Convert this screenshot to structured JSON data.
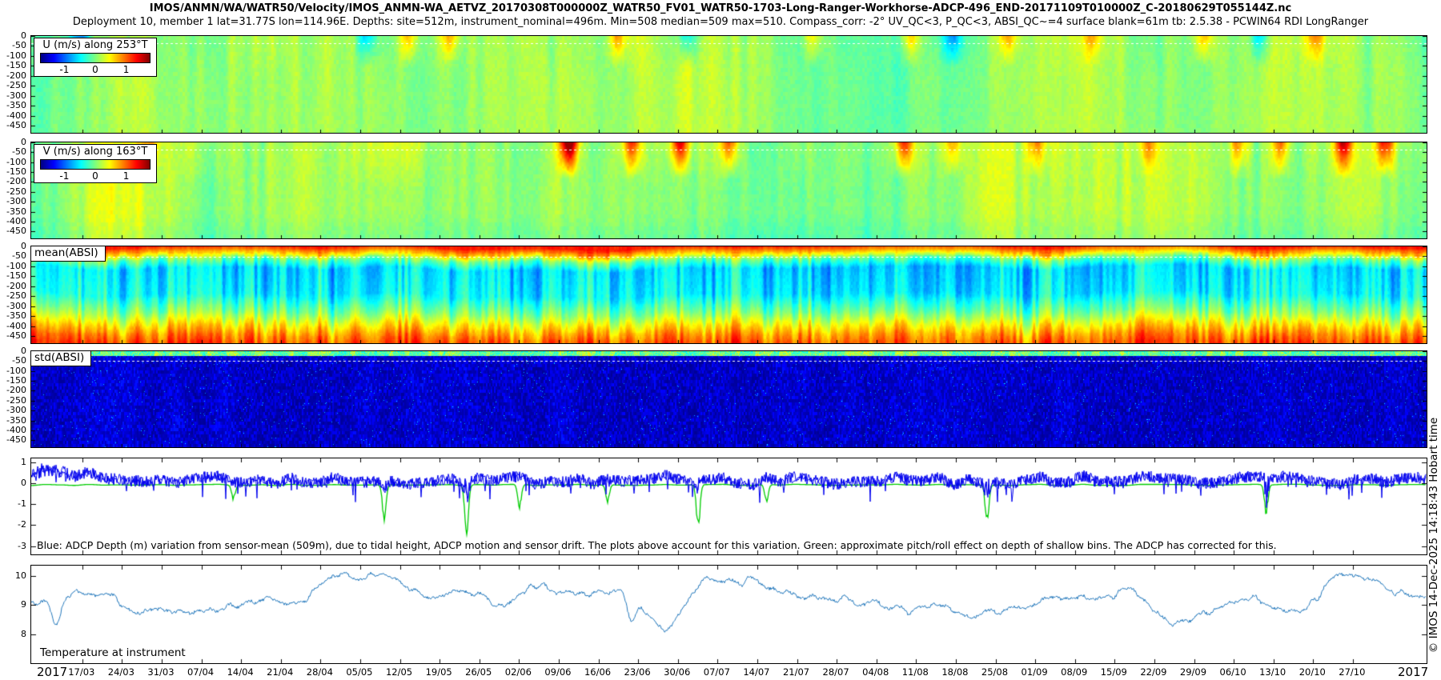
{
  "header": {
    "line1": "IMOS/ANMN/WA/WATR50/Velocity/IMOS_ANMN-WA_AETVZ_20170308T000000Z_WATR50_FV01_WATR50-1703-Long-Ranger-Workhorse-ADCP-496_END-20171109T010000Z_C-20180629T055144Z.nc",
    "line2": "Deployment 10, member 1 lat=31.77S lon=114.96E. Depths: site=512m, instrument_nominal=496m. Min=508 median=509 max=510. Compass_corr: -2° UV_QC<3, P_QC<3, ABSI_QC~=4 surface blank=61m tb: 2.5.38 - PCWIN64 RDI LongRanger"
  },
  "panels": [
    {
      "id": "u_velocity",
      "legend_title": "U (m/s) along 253°T",
      "colorbar_ticks": [
        "-1",
        "0",
        "1"
      ],
      "y_tick_labels": [
        "0",
        "-50",
        "-100",
        "-150",
        "-200",
        "-250",
        "-300",
        "-350",
        "-400",
        "-450"
      ]
    },
    {
      "id": "v_velocity",
      "legend_title": "V (m/s) along 163°T",
      "colorbar_ticks": [
        "-1",
        "0",
        "1"
      ],
      "y_tick_labels": [
        "0",
        "-50",
        "-100",
        "-150",
        "-200",
        "-250",
        "-300",
        "-350",
        "-400",
        "-450"
      ]
    },
    {
      "id": "mean_absi",
      "label": "mean(ABSI)",
      "y_tick_labels": [
        "0",
        "-50",
        "-100",
        "-150",
        "-200",
        "-250",
        "-300",
        "-350",
        "-400",
        "-450"
      ]
    },
    {
      "id": "std_absi",
      "label": "std(ABSI)",
      "y_tick_labels": [
        "0",
        "-50",
        "-100",
        "-150",
        "-200",
        "-250",
        "-300",
        "-350",
        "-400",
        "-450"
      ]
    },
    {
      "id": "depth_variation",
      "y_tick_labels": [
        "1",
        "0",
        "-1",
        "-2",
        "-3"
      ],
      "annotation": "Blue: ADCP Depth (m) variation from sensor-mean (509m), due to tidal height, ADCP motion and sensor drift. The plots above account for this variation. Green: approximate pitch/roll effect on depth of shallow bins. The ADCP has corrected for this."
    },
    {
      "id": "temperature",
      "label": "Temperature at instrument",
      "y_tick_labels": [
        "10",
        "9",
        "8"
      ]
    }
  ],
  "x_axis": {
    "year_left": "2017",
    "year_right": "2017",
    "date_ticks": [
      "17/03",
      "24/03",
      "31/03",
      "07/04",
      "14/04",
      "21/04",
      "28/04",
      "05/05",
      "12/05",
      "19/05",
      "26/05",
      "02/06",
      "09/06",
      "16/06",
      "23/06",
      "30/06",
      "07/07",
      "14/07",
      "21/07",
      "28/07",
      "04/08",
      "11/08",
      "18/08",
      "25/08",
      "01/09",
      "08/09",
      "15/09",
      "22/09",
      "29/09",
      "06/10",
      "13/10",
      "20/10",
      "27/10"
    ]
  },
  "watermark": "© IMOS 14-Dec-2025 14:18:43 Hobart time",
  "colors": {
    "line_blue": "#0000ee",
    "line_green": "#00cc00",
    "temp_blue": "#2277bb",
    "colormap": "jet"
  },
  "chart_data": [
    {
      "type": "heatmap",
      "title": "U (m/s) along 253°T",
      "x_range": [
        "08/03/2017",
        "09/11/2017"
      ],
      "y_axis_depth_m": [
        0,
        -50,
        -100,
        -150,
        -200,
        -250,
        -300,
        -350,
        -400,
        -450
      ],
      "y_range_m": [
        0,
        -485
      ],
      "value_range_mps": [
        -1.5,
        1.5
      ],
      "colormap": "jet",
      "summary": "velocity near 0 m/s (green) at most depths/times; intermittent surface-intensified events",
      "surface_events": [
        [
          0.035,
          -0.7
        ],
        [
          0.24,
          -0.5
        ],
        [
          0.27,
          0.5
        ],
        [
          0.3,
          0.45
        ],
        [
          0.42,
          0.5
        ],
        [
          0.47,
          -0.5
        ],
        [
          0.56,
          0.4
        ],
        [
          0.63,
          0.45
        ],
        [
          0.66,
          -0.55
        ],
        [
          0.7,
          0.5
        ],
        [
          0.76,
          0.4
        ],
        [
          0.84,
          0.5
        ],
        [
          0.88,
          -0.5
        ],
        [
          0.92,
          0.45
        ]
      ]
    },
    {
      "type": "heatmap",
      "title": "V (m/s) along 163°T",
      "x_range": [
        "08/03/2017",
        "09/11/2017"
      ],
      "y_axis_depth_m": [
        0,
        -50,
        -100,
        -150,
        -200,
        -250,
        -300,
        -350,
        -400,
        -450
      ],
      "y_range_m": [
        0,
        -485
      ],
      "value_range_mps": [
        -1.5,
        1.5
      ],
      "colormap": "jet",
      "summary": "mostly 0-0.3 m/s (green-yellow) with strong positive (orange-red, up to ~1.3 m/s) surface events mid-deployment and late deployment",
      "surface_events": [
        [
          0.085,
          0.5
        ],
        [
          0.385,
          1.5
        ],
        [
          0.43,
          0.8
        ],
        [
          0.465,
          1.0
        ],
        [
          0.5,
          0.8
        ],
        [
          0.625,
          0.9
        ],
        [
          0.66,
          0.6
        ],
        [
          0.72,
          0.6
        ],
        [
          0.8,
          0.5
        ],
        [
          0.865,
          0.6
        ],
        [
          0.895,
          0.7
        ],
        [
          0.94,
          1.1
        ],
        [
          0.97,
          1.0
        ]
      ]
    },
    {
      "type": "heatmap",
      "title": "mean(ABSI)",
      "x_range": [
        "08/03/2017",
        "09/11/2017"
      ],
      "y_axis_depth_m": [
        0,
        -50,
        -100,
        -150,
        -200,
        -250,
        -300,
        -350,
        -400,
        -450
      ],
      "y_range_m": [
        0,
        -485
      ],
      "colormap": "jet",
      "summary": "high backscatter (orange/red) in top ~40 m and below ~380 m; low (cyan/blue) 100-250 m; strong diurnal vertical striping",
      "depth_profile": [
        [
          0,
          1.25
        ],
        [
          18,
          0.9
        ],
        [
          38,
          0.5
        ],
        [
          65,
          -0.1
        ],
        [
          110,
          -0.6
        ],
        [
          240,
          -0.5
        ],
        [
          330,
          0.0
        ],
        [
          395,
          0.5
        ],
        [
          445,
          0.85
        ],
        [
          485,
          1.05
        ]
      ]
    },
    {
      "type": "heatmap",
      "title": "std(ABSI)",
      "x_range": [
        "08/03/2017",
        "09/11/2017"
      ],
      "y_axis_depth_m": [
        0,
        -50,
        -100,
        -150,
        -200,
        -250,
        -300,
        -350,
        -400,
        -450
      ],
      "y_range_m": [
        0,
        -485
      ],
      "colormap": "jet",
      "summary": "uniformly low std (dark navy) below ~60 m; elevated speckled cyan/green band in top ~40 m"
    },
    {
      "type": "line",
      "title": "ADCP depth variation",
      "y_ticks": [
        1,
        0,
        -1,
        -2,
        -3
      ],
      "y_range": [
        -3.4,
        1.2
      ],
      "series": [
        {
          "name": "ADCP Depth (m) variation from sensor-mean (blue)",
          "approx_weekly": [
            0.4,
            0.5,
            0.2,
            0.1,
            0.2,
            0.15,
            0.1,
            0.2,
            0.1,
            0.05,
            0.15,
            0.2,
            0.1,
            0.1,
            0.2,
            0.3,
            0.1,
            0.1,
            0.15,
            0.1,
            0.1,
            0.2,
            0.1,
            0.1,
            0.15,
            0.2,
            0.25,
            0.1,
            0.15,
            0.2,
            0.15,
            0.1,
            0.2,
            0.15
          ],
          "dips": [
            [
              0.253,
              -0.9
            ],
            [
              0.312,
              -1.1
            ],
            [
              0.478,
              -1.0
            ],
            [
              0.685,
              -0.9
            ],
            [
              0.885,
              -0.8
            ]
          ]
        },
        {
          "name": "pitch/roll effect on shallow bins (green)",
          "baseline": -0.07,
          "spikes": [
            [
              0.145,
              -0.8
            ],
            [
              0.253,
              -1.9
            ],
            [
              0.312,
              -2.75
            ],
            [
              0.35,
              -1.3
            ],
            [
              0.413,
              -1.0
            ],
            [
              0.478,
              -2.3
            ],
            [
              0.527,
              -1.0
            ],
            [
              0.685,
              -2.15
            ],
            [
              0.885,
              -1.5
            ]
          ]
        }
      ]
    },
    {
      "type": "line",
      "title": "Temperature at instrument",
      "y_ticks": [
        10,
        9,
        8
      ],
      "y_range": [
        7.0,
        10.35
      ],
      "approx_weekly": [
        8.8,
        9.3,
        9.2,
        8.8,
        9.0,
        9.1,
        9.0,
        9.6,
        10.3,
        9.4,
        9.4,
        9.1,
        9.6,
        9.3,
        9.5,
        8.3,
        9.8,
        9.9,
        9.2,
        9.0,
        9.2,
        9.0,
        8.5,
        8.7,
        9.2,
        9.0,
        9.4,
        8.3,
        9.1,
        9.3,
        9.0,
        9.9,
        9.6,
        9.3
      ],
      "sharp_dips": [
        [
          0.018,
          -0.9
        ],
        [
          0.43,
          -0.7
        ]
      ]
    }
  ]
}
